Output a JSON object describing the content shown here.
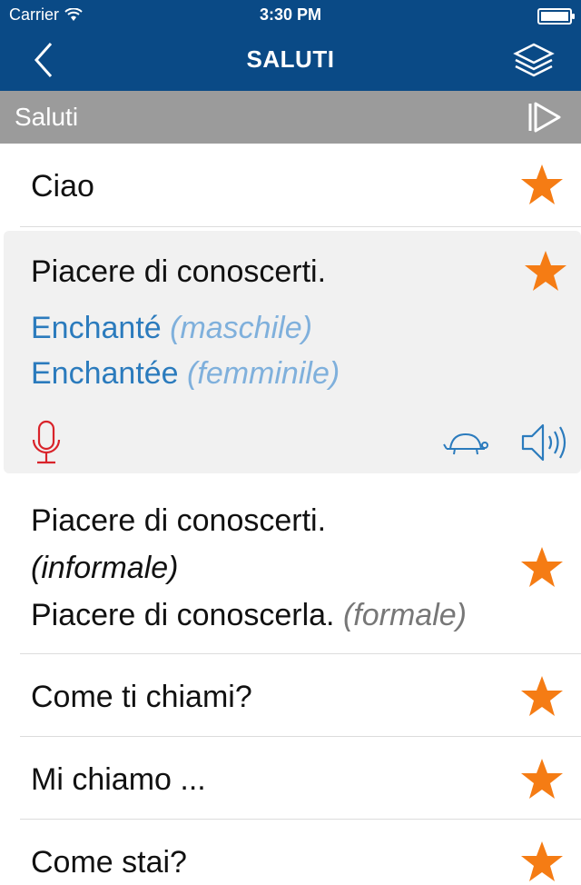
{
  "status": {
    "carrier": "Carrier",
    "time": "3:30 PM",
    "battery_level": 1.0
  },
  "nav": {
    "title": "SALUTI"
  },
  "section": {
    "label": "Saluti"
  },
  "rows": [
    {
      "text": "Ciao",
      "favorite": true
    },
    {
      "text": "Piacere di conoscerti.",
      "favorite": true,
      "translations": [
        {
          "text": "Enchanté",
          "hint": "(maschile)"
        },
        {
          "text": "Enchantée",
          "hint": "(femminile)"
        }
      ]
    },
    {
      "line1": "Piacere di conoscerti.",
      "line2": "(informale)",
      "line3": "Piacere di conoscerla.",
      "line3_hint": "(formale)",
      "favorite": true
    },
    {
      "text": "Come ti chiami?",
      "favorite": true
    },
    {
      "text": "Mi chiamo ...",
      "favorite": true
    },
    {
      "text": "Come stai?",
      "favorite": true
    }
  ],
  "colors": {
    "nav": "#0a4a86",
    "section": "#9b9b9b",
    "star": "#f57c14",
    "mic": "#d9232a",
    "translation": "#2b7bbd"
  },
  "icons": [
    "back-chevron-icon",
    "layers-icon",
    "play-all-icon",
    "star-icon",
    "microphone-icon",
    "turtle-icon",
    "speaker-icon"
  ]
}
